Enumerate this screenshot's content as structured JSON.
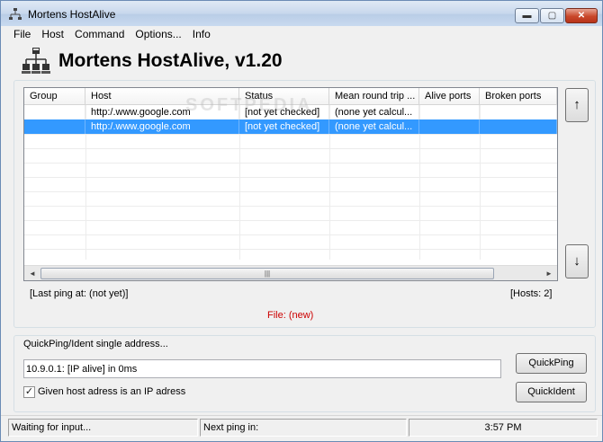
{
  "window": {
    "title": "Mortens HostAlive",
    "minimize_glyph": "▬",
    "maximize_glyph": "▢",
    "close_glyph": "✕"
  },
  "menu": [
    "File",
    "Host",
    "Command",
    "Options...",
    "Info"
  ],
  "header": {
    "title": "Mortens HostAlive, v1.20"
  },
  "hosts_table": {
    "columns": [
      "Group",
      "Host",
      "Status",
      "Mean round trip ...",
      "Alive ports",
      "Broken ports"
    ],
    "rows": [
      {
        "group": "",
        "host": "http:/.www.google.com",
        "status": "[not yet checked]",
        "mean_rtt": "(none yet calcul...",
        "alive_ports": "",
        "broken_ports": "",
        "selected": false
      },
      {
        "group": "",
        "host": "http:/.www.google.com",
        "status": "[not yet checked]",
        "mean_rtt": "(none yet calcul...",
        "alive_ports": "",
        "broken_ports": "",
        "selected": true
      }
    ],
    "scroll_left": "◄",
    "scroll_right": "►",
    "scroll_thumb_grip": "|||"
  },
  "nav_buttons": {
    "up": "↑",
    "down": "↓"
  },
  "info": {
    "last_ping": "[Last ping at: (not yet)]",
    "hosts_count": "[Hosts: 2]",
    "file": "File: (new)"
  },
  "quick": {
    "label": "QuickPing/Ident single address...",
    "input_value": "10.9.0.1: [IP alive] in 0ms",
    "checkbox_checked": true,
    "checkbox_mark": "✓",
    "checkbox_label": "Given host adress is an IP adress",
    "quickping_label": "QuickPing",
    "quickident_label": "QuickIdent"
  },
  "statusbar": {
    "state": "Waiting for input...",
    "next_ping": "Next ping in:",
    "clock": "3:57 PM"
  },
  "watermark": "SOFTPEDIA",
  "colors": {
    "selection": "#3399ff",
    "file_status": "#cc0000"
  }
}
